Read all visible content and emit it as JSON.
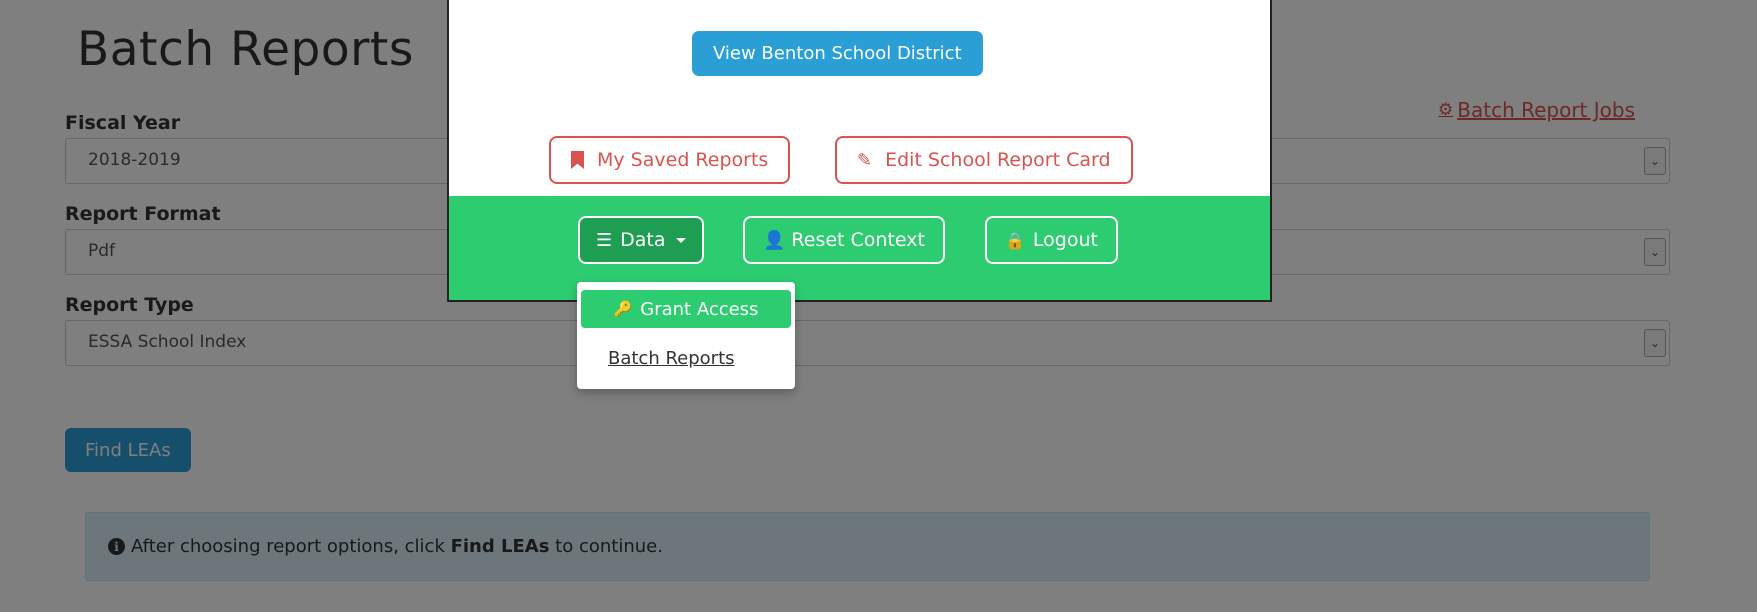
{
  "page": {
    "title": "Batch Reports",
    "jobs_link": "Batch Report Jobs",
    "fields": [
      {
        "label": "Fiscal Year",
        "value": "2018-2019"
      },
      {
        "label": "Report Format",
        "value": "Pdf"
      },
      {
        "label": "Report Type",
        "value": "ESSA School Index"
      }
    ],
    "find_button": "Find LEAs",
    "info": {
      "prefix": "After choosing report options, click ",
      "bold": "Find LEAs",
      "suffix": " to continue."
    }
  },
  "modal": {
    "view_district": "View Benton School District",
    "saved_reports": "My Saved Reports",
    "edit_card": "Edit School Report Card",
    "data_button": "Data",
    "reset_context": "Reset Context",
    "logout": "Logout"
  },
  "dropdown": {
    "items": [
      {
        "label": "Grant Access",
        "icon": "key-icon",
        "active": true
      },
      {
        "label": "Batch Reports",
        "active": false
      }
    ]
  },
  "colors": {
    "primary_blue": "#2a9fd6",
    "danger_red": "#d9534f",
    "success_green": "#2ecc71",
    "info_bg": "#d9edf7"
  }
}
